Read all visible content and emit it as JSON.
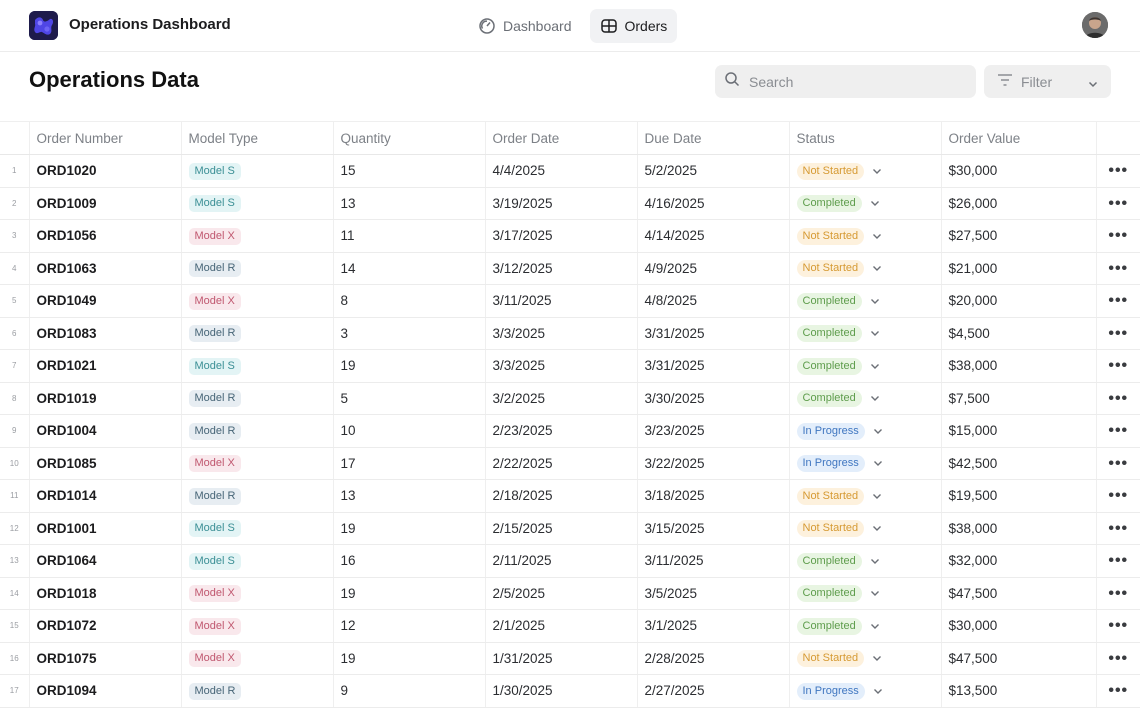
{
  "app": {
    "title": "Operations Dashboard"
  },
  "nav": [
    {
      "label": "Dashboard",
      "icon": "dashboard-gauge-icon",
      "active": false
    },
    {
      "label": "Orders",
      "icon": "table-icon",
      "active": true
    }
  ],
  "page": {
    "title": "Operations Data"
  },
  "search": {
    "placeholder": "Search",
    "value": ""
  },
  "filter": {
    "label": "Filter"
  },
  "table": {
    "columns": [
      "Order Number",
      "Model Type",
      "Quantity",
      "Order Date",
      "Due Date",
      "Status",
      "Order Value"
    ],
    "rows": [
      {
        "index": "1",
        "order": "ORD1020",
        "model": "Model S",
        "quantity": "15",
        "order_date": "4/4/2025",
        "due_date": "5/2/2025",
        "status": "Not Started",
        "value": "$30,000"
      },
      {
        "index": "2",
        "order": "ORD1009",
        "model": "Model S",
        "quantity": "13",
        "order_date": "3/19/2025",
        "due_date": "4/16/2025",
        "status": "Completed",
        "value": "$26,000"
      },
      {
        "index": "3",
        "order": "ORD1056",
        "model": "Model X",
        "quantity": "11",
        "order_date": "3/17/2025",
        "due_date": "4/14/2025",
        "status": "Not Started",
        "value": "$27,500"
      },
      {
        "index": "4",
        "order": "ORD1063",
        "model": "Model R",
        "quantity": "14",
        "order_date": "3/12/2025",
        "due_date": "4/9/2025",
        "status": "Not Started",
        "value": "$21,000"
      },
      {
        "index": "5",
        "order": "ORD1049",
        "model": "Model X",
        "quantity": "8",
        "order_date": "3/11/2025",
        "due_date": "4/8/2025",
        "status": "Completed",
        "value": "$20,000"
      },
      {
        "index": "6",
        "order": "ORD1083",
        "model": "Model R",
        "quantity": "3",
        "order_date": "3/3/2025",
        "due_date": "3/31/2025",
        "status": "Completed",
        "value": "$4,500"
      },
      {
        "index": "7",
        "order": "ORD1021",
        "model": "Model S",
        "quantity": "19",
        "order_date": "3/3/2025",
        "due_date": "3/31/2025",
        "status": "Completed",
        "value": "$38,000"
      },
      {
        "index": "8",
        "order": "ORD1019",
        "model": "Model R",
        "quantity": "5",
        "order_date": "3/2/2025",
        "due_date": "3/30/2025",
        "status": "Completed",
        "value": "$7,500"
      },
      {
        "index": "9",
        "order": "ORD1004",
        "model": "Model R",
        "quantity": "10",
        "order_date": "2/23/2025",
        "due_date": "3/23/2025",
        "status": "In Progress",
        "value": "$15,000"
      },
      {
        "index": "10",
        "order": "ORD1085",
        "model": "Model X",
        "quantity": "17",
        "order_date": "2/22/2025",
        "due_date": "3/22/2025",
        "status": "In Progress",
        "value": "$42,500"
      },
      {
        "index": "11",
        "order": "ORD1014",
        "model": "Model R",
        "quantity": "13",
        "order_date": "2/18/2025",
        "due_date": "3/18/2025",
        "status": "Not Started",
        "value": "$19,500"
      },
      {
        "index": "12",
        "order": "ORD1001",
        "model": "Model S",
        "quantity": "19",
        "order_date": "2/15/2025",
        "due_date": "3/15/2025",
        "status": "Not Started",
        "value": "$38,000"
      },
      {
        "index": "13",
        "order": "ORD1064",
        "model": "Model S",
        "quantity": "16",
        "order_date": "2/11/2025",
        "due_date": "3/11/2025",
        "status": "Completed",
        "value": "$32,000"
      },
      {
        "index": "14",
        "order": "ORD1018",
        "model": "Model X",
        "quantity": "19",
        "order_date": "2/5/2025",
        "due_date": "3/5/2025",
        "status": "Completed",
        "value": "$47,500"
      },
      {
        "index": "15",
        "order": "ORD1072",
        "model": "Model X",
        "quantity": "12",
        "order_date": "2/1/2025",
        "due_date": "3/1/2025",
        "status": "Completed",
        "value": "$30,000"
      },
      {
        "index": "16",
        "order": "ORD1075",
        "model": "Model X",
        "quantity": "19",
        "order_date": "1/31/2025",
        "due_date": "2/28/2025",
        "status": "Not Started",
        "value": "$47,500"
      },
      {
        "index": "17",
        "order": "ORD1094",
        "model": "Model R",
        "quantity": "9",
        "order_date": "1/30/2025",
        "due_date": "2/27/2025",
        "status": "In Progress",
        "value": "$13,500"
      }
    ]
  },
  "colors": {
    "status_not_started": "#d69a33",
    "status_completed": "#5e9d4c",
    "status_in_progress": "#3f76c0",
    "model_s": "#3b8f95",
    "model_x": "#c0576f",
    "model_r": "#476577"
  }
}
